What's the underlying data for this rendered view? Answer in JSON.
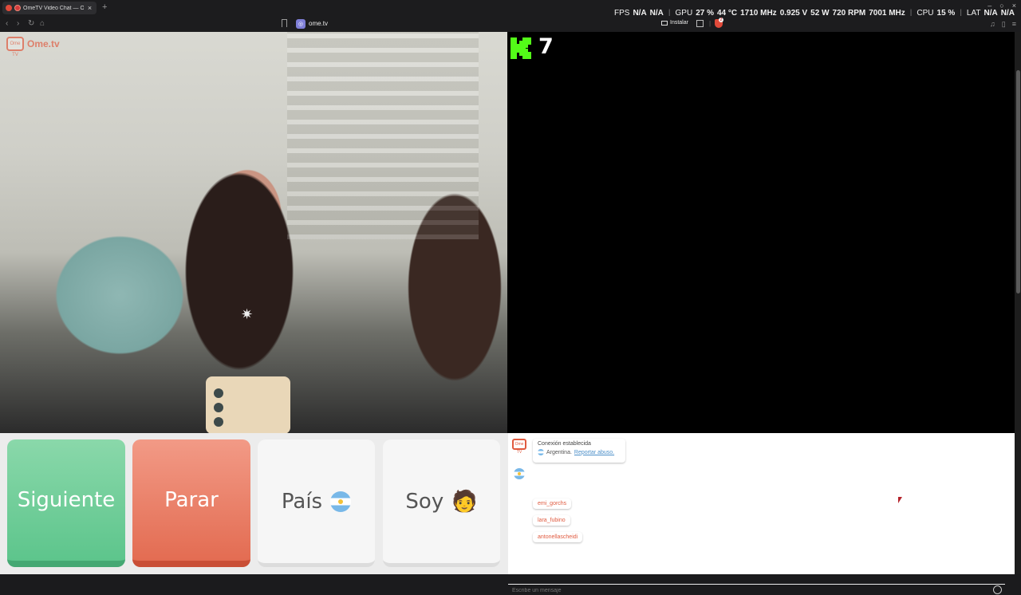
{
  "browser": {
    "tab_title": "OmeTV Video Chat — Omeg",
    "new_tab": "+",
    "tab_close": "×",
    "url": "ome.tv",
    "install_label": "Instalar",
    "ext_badge": "2",
    "nav": {
      "back": "‹",
      "forward": "›",
      "reload": "↻",
      "home": "⌂"
    },
    "right_icons": [
      "♫",
      "▯",
      "≡"
    ],
    "window_controls": [
      "–",
      "○",
      "×"
    ]
  },
  "hud": {
    "fps_label": "FPS",
    "fps_val1": "N/A",
    "fps_val2": "N/A",
    "gpu_label": "GPU",
    "gpu_load": "27 %",
    "gpu_temp": "44 °C",
    "gpu_clock": "1710 MHz",
    "gpu_volt": "0.925 V",
    "gpu_power": "52 W",
    "gpu_fan": "720 RPM",
    "gpu_mem": "7001 MHz",
    "cpu_label": "CPU",
    "cpu_load": "15 %",
    "lat_label": "LAT",
    "lat_val1": "N/A",
    "lat_val2": "N/A"
  },
  "page": {
    "brand_name": "Ome.tv",
    "brand_box": "Ome TV",
    "kick_count": "7",
    "buttons": {
      "next": "Siguiente",
      "stop": "Parar",
      "country": "País",
      "gender": "Soy",
      "gender_emoji": "🧑"
    },
    "chat": {
      "system_line": "Conexión establecida",
      "country": "Argentina.",
      "report": "Reportar abuso.",
      "messages": [
        "emi_gorchs",
        "lara_fubino",
        "antonellascheidi"
      ],
      "input_placeholder": "Escribe un mensaje"
    }
  },
  "colors": {
    "next_green": "#5dc58c",
    "stop_red": "#e36c52",
    "brand_orange": "#e05a3f",
    "kick_green": "#53fc18"
  }
}
